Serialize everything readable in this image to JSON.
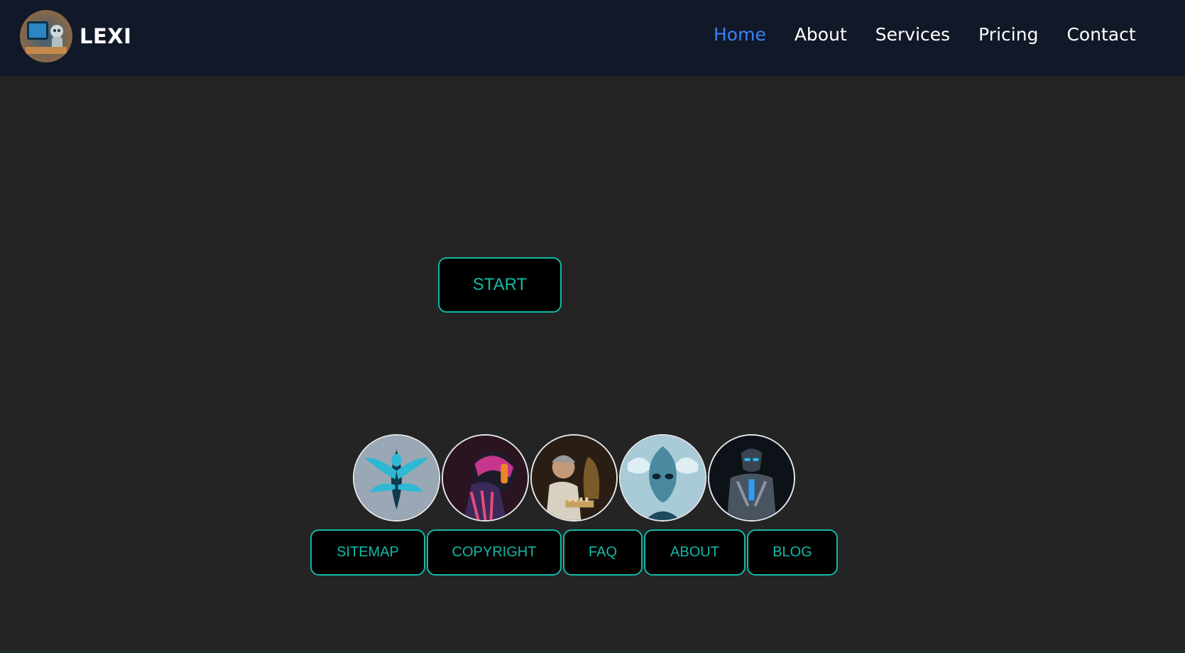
{
  "brand": {
    "name": "LEXI",
    "logo_icon": "robot-logo-icon"
  },
  "nav": {
    "items": [
      {
        "label": "Home",
        "active": true
      },
      {
        "label": "About",
        "active": false
      },
      {
        "label": "Services",
        "active": false
      },
      {
        "label": "Pricing",
        "active": false
      },
      {
        "label": "Contact",
        "active": false
      }
    ]
  },
  "hero": {
    "start_label": "START"
  },
  "avatars": [
    {
      "icon": "alien-emblem-avatar"
    },
    {
      "icon": "neon-helmet-avatar"
    },
    {
      "icon": "inventor-robot-avatar"
    },
    {
      "icon": "blue-alien-avatar"
    },
    {
      "icon": "cyborg-armor-avatar"
    }
  ],
  "footer": {
    "links": [
      {
        "label": "SITEMAP"
      },
      {
        "label": "COPYRIGHT"
      },
      {
        "label": "FAQ"
      },
      {
        "label": "ABOUT"
      },
      {
        "label": "BLOG"
      }
    ]
  },
  "colors": {
    "nav_bg": "#111827",
    "page_bg": "#242424",
    "accent": "#14b8a6",
    "active_link": "#3b82f6"
  }
}
